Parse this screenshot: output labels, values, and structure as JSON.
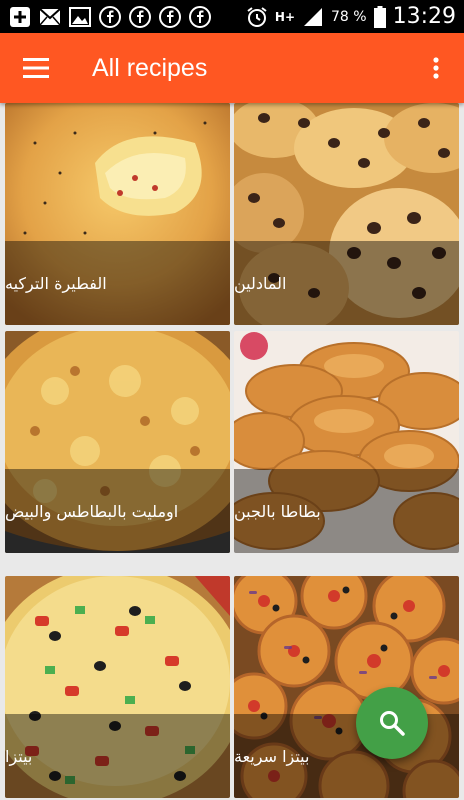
{
  "status_bar": {
    "battery_percent": "78 %",
    "time": "13:29",
    "network": "H+",
    "left_icons": [
      "add-box-icon",
      "mail-icon",
      "image-icon",
      "facebook-icon",
      "facebook-icon",
      "facebook-icon",
      "facebook-icon"
    ],
    "right_icons": [
      "alarm-icon",
      "network-icon",
      "signal-icon",
      "battery-icon"
    ]
  },
  "app_bar": {
    "title": "All recipes",
    "menu_icon": "hamburger-menu-icon",
    "overflow_icon": "more-vert-icon",
    "color": "#ff5722"
  },
  "recipes": [
    {
      "name": "الفطيرة التركيه"
    },
    {
      "name": "المادلين"
    },
    {
      "name": "اومليت بالبطاطس والبيض"
    },
    {
      "name": "بطاطا بالجبن"
    },
    {
      "name": "بيتزا"
    },
    {
      "name": "بيتزا سريعة"
    }
  ],
  "fab": {
    "icon": "search-icon",
    "color": "#43a047"
  }
}
